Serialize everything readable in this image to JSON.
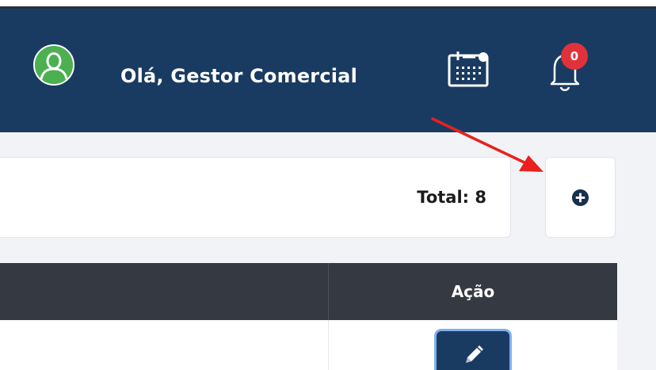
{
  "header": {
    "greeting": "Olá, Gestor Comercial",
    "avatar_color": "#4caf50",
    "background": "#1a3b61",
    "notifications": {
      "count": "0",
      "badge_color": "#e0323b"
    },
    "icons": [
      "user-avatar-icon",
      "calendar-icon",
      "bell-icon"
    ]
  },
  "summary": {
    "total_label": "Total: 8"
  },
  "add_button": {
    "icon": "plus-circle-icon"
  },
  "table": {
    "columns": [
      "",
      "Ação"
    ],
    "rows": [
      {
        "action_icon": "pencil-icon"
      }
    ]
  },
  "annotation": {
    "arrow_color": "#e8211d",
    "points_to": "add-button"
  }
}
